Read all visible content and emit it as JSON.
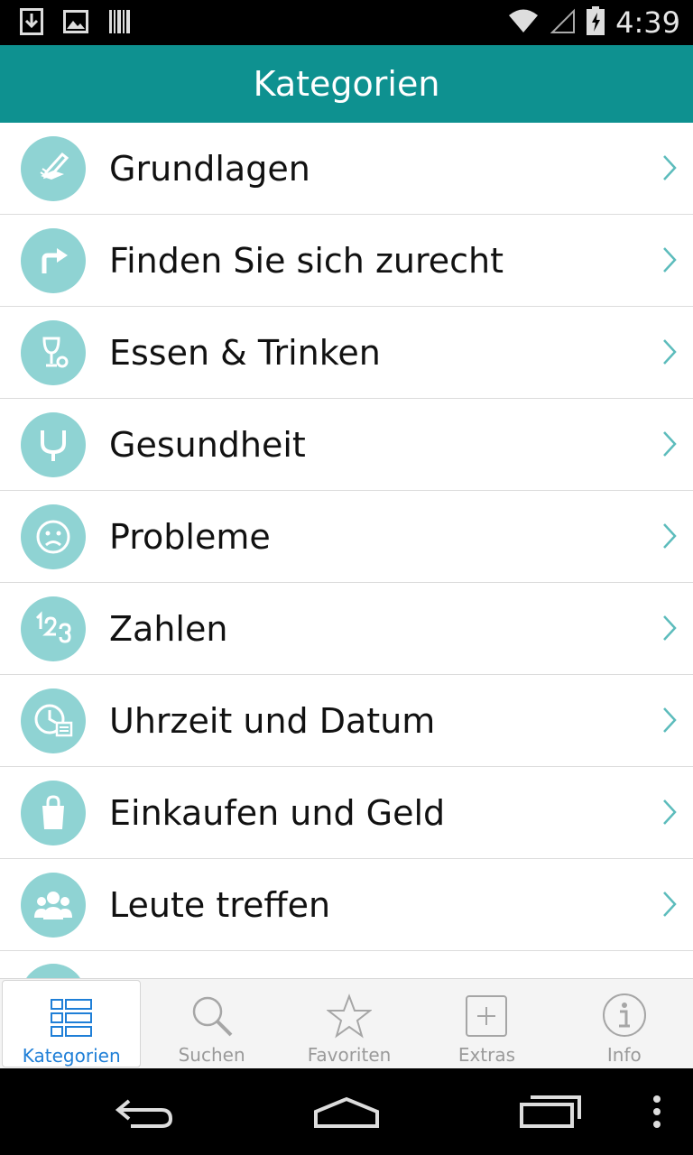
{
  "status_bar": {
    "time": "4:39"
  },
  "app_bar": {
    "title": "Kategorien"
  },
  "categories": [
    {
      "label": "Grundlagen",
      "icon": "pen-paper-icon"
    },
    {
      "label": "Finden Sie sich zurecht",
      "icon": "turn-right-arrow-icon"
    },
    {
      "label": "Essen & Trinken",
      "icon": "wine-glass-icon"
    },
    {
      "label": "Gesundheit",
      "icon": "stethoscope-icon"
    },
    {
      "label": "Probleme",
      "icon": "sad-face-icon"
    },
    {
      "label": "Zahlen",
      "icon": "numbers-123-icon"
    },
    {
      "label": "Uhrzeit und Datum",
      "icon": "clock-calendar-icon"
    },
    {
      "label": "Einkaufen und Geld",
      "icon": "shopping-bag-icon"
    },
    {
      "label": "Leute treffen",
      "icon": "people-group-icon"
    }
  ],
  "tabs": [
    {
      "label": "Kategorien",
      "icon": "list-grid-icon",
      "active": true
    },
    {
      "label": "Suchen",
      "icon": "search-icon",
      "active": false
    },
    {
      "label": "Favoriten",
      "icon": "star-icon",
      "active": false
    },
    {
      "label": "Extras",
      "icon": "plus-box-icon",
      "active": false
    },
    {
      "label": "Info",
      "icon": "info-icon",
      "active": false
    }
  ],
  "colors": {
    "app_bar": "#0e9190",
    "icon_circle": "#8fd3d3",
    "chevron": "#5cbcbc",
    "active_tab": "#1f7fd7",
    "inactive_tab": "#9a9a9a"
  }
}
